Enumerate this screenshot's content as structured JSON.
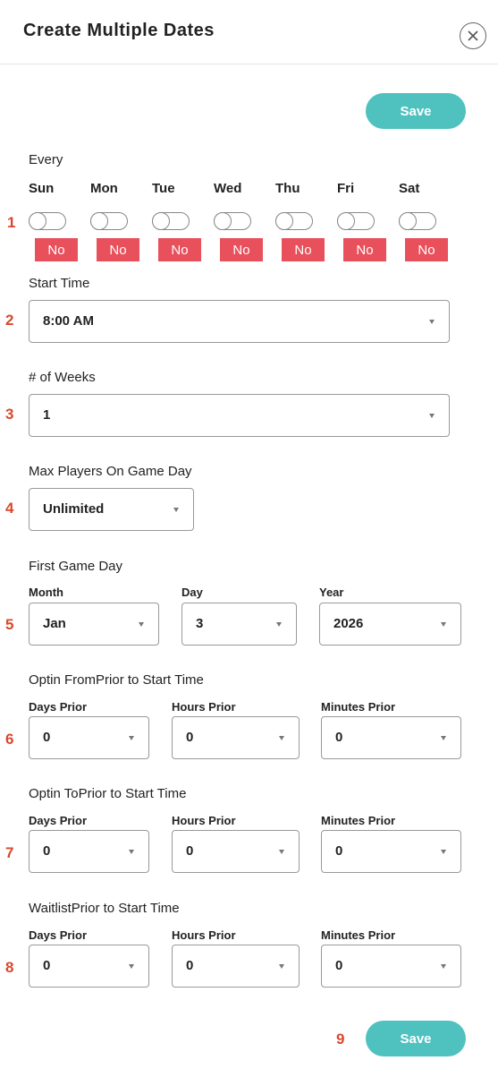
{
  "header": {
    "title": "Create Multiple Dates",
    "close_icon": "close-circle-icon"
  },
  "save_label": "Save",
  "every": {
    "label": "Every",
    "days": [
      {
        "name": "Sun",
        "state": "No",
        "on": false
      },
      {
        "name": "Mon",
        "state": "No",
        "on": false
      },
      {
        "name": "Tue",
        "state": "No",
        "on": false
      },
      {
        "name": "Wed",
        "state": "No",
        "on": false
      },
      {
        "name": "Thu",
        "state": "No",
        "on": false
      },
      {
        "name": "Fri",
        "state": "No",
        "on": false
      },
      {
        "name": "Sat",
        "state": "No",
        "on": false
      }
    ]
  },
  "start_time": {
    "label": "Start Time",
    "value": "8:00 AM"
  },
  "weeks": {
    "label": "# of Weeks",
    "value": "1"
  },
  "max_players": {
    "label": "Max Players On Game Day",
    "value": "Unlimited"
  },
  "first_game_day": {
    "label": "First Game Day",
    "month": {
      "label": "Month",
      "value": "Jan"
    },
    "day": {
      "label": "Day",
      "value": "3"
    },
    "year": {
      "label": "Year",
      "value": "2026"
    }
  },
  "optin_from": {
    "label": "Optin FromPrior to Start Time",
    "days": {
      "label": "Days Prior",
      "value": "0"
    },
    "hours": {
      "label": "Hours Prior",
      "value": "0"
    },
    "minutes": {
      "label": "Minutes Prior",
      "value": "0"
    }
  },
  "optin_to": {
    "label": "Optin ToPrior to Start Time",
    "days": {
      "label": "Days Prior",
      "value": "0"
    },
    "hours": {
      "label": "Hours Prior",
      "value": "0"
    },
    "minutes": {
      "label": "Minutes Prior",
      "value": "0"
    }
  },
  "waitlist": {
    "label": "WaitlistPrior to Start Time",
    "days": {
      "label": "Days Prior",
      "value": "0"
    },
    "hours": {
      "label": "Hours Prior",
      "value": "0"
    },
    "minutes": {
      "label": "Minutes Prior",
      "value": "0"
    }
  },
  "annotations": [
    "1",
    "2",
    "3",
    "4",
    "5",
    "6",
    "7",
    "8",
    "9"
  ],
  "colors": {
    "accent": "#4fc1bf",
    "no_badge": "#e8505b",
    "annotation": "#d9482c"
  }
}
